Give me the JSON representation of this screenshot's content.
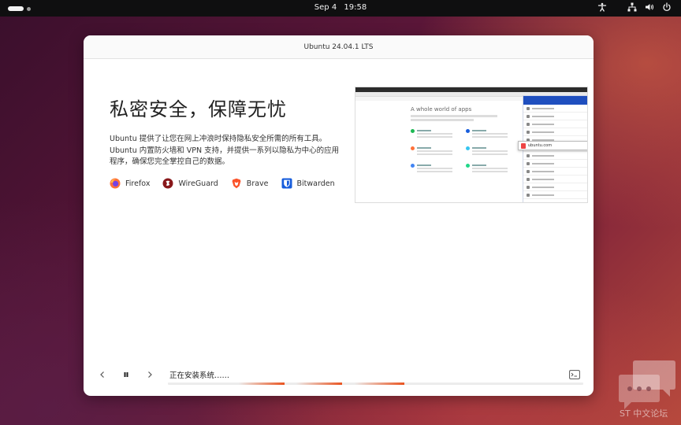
{
  "topbar": {
    "date": "Sep 4",
    "time": "19:58",
    "icons": [
      "accessibility-icon",
      "network-icon",
      "volume-icon",
      "power-icon"
    ]
  },
  "window": {
    "title": "Ubuntu 24.04.1 LTS",
    "headline": "私密安全，保障无忧",
    "description_line1": "Ubuntu 提供了让您在网上冲浪时保持隐私安全所需的所有工具。",
    "description_line2": "Ubuntu 内置防火墙和 VPN 支持，并提供一系列以隐私为中心的应用程序，确保您完全掌控自己的数据。",
    "apps": [
      {
        "label": "Firefox",
        "icon": "firefox-icon",
        "color": "#ff7139"
      },
      {
        "label": "WireGuard",
        "icon": "wireguard-icon",
        "color": "#88171a"
      },
      {
        "label": "Brave",
        "icon": "brave-icon",
        "color": "#fb542b"
      },
      {
        "label": "Bitwarden",
        "icon": "bitwarden-icon",
        "color": "#175ddc"
      }
    ],
    "preview": {
      "heading": "A whole world of apps",
      "popup": "ubuntu.com"
    },
    "status": "正在安装系统……",
    "progress_segments": [
      {
        "start": 0.17,
        "end": 0.28
      },
      {
        "start": 0.31,
        "end": 0.42
      },
      {
        "start": 0.45,
        "end": 0.57
      }
    ]
  },
  "colors": {
    "accent": "#e95420",
    "titlebar_bg": "#fafafa",
    "topbar_bg": "#0f0f10"
  },
  "watermark": {
    "text": "ST 中文论坛"
  }
}
